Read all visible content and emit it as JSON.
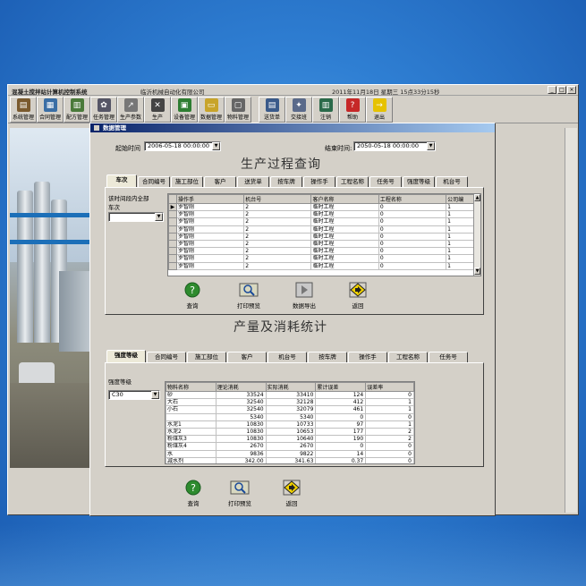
{
  "window": {
    "title": "混凝土搅拌站计算机控制系统",
    "company": "临沂机械自动化有限公司",
    "datetime": "2011年11月18日  星期三  15点33分15秒",
    "min": "_",
    "max": "□",
    "close": "×"
  },
  "toolbar": [
    {
      "label": "系统管理",
      "icon": "#7a5a2e",
      "glyph": "▤"
    },
    {
      "label": "合同管理",
      "icon": "#3a6ea5",
      "glyph": "▦"
    },
    {
      "label": "配方管理",
      "icon": "#4a7a3a",
      "glyph": "▥"
    },
    {
      "label": "任务管理",
      "icon": "#556",
      "glyph": "✿"
    },
    {
      "label": "生产参数",
      "icon": "#777",
      "glyph": "↗"
    },
    {
      "label": "生产",
      "icon": "#444",
      "glyph": "✕"
    },
    {
      "label": "设备管理",
      "icon": "#2e7d32",
      "glyph": "▣"
    },
    {
      "label": "数据管理",
      "icon": "#c8a42a",
      "glyph": "▭"
    },
    {
      "label": "物料管理",
      "icon": "#666",
      "glyph": "▢"
    },
    {
      "label": "送货单",
      "icon": "#3a5a8a",
      "glyph": "▤"
    },
    {
      "label": "交接班",
      "icon": "#5a6a8a",
      "glyph": "✦"
    },
    {
      "label": "注销",
      "icon": "#2a6a4a",
      "glyph": "▥"
    },
    {
      "label": "帮助",
      "icon": "#c62828",
      "glyph": "?"
    },
    {
      "label": "退出",
      "icon": "#e6c200",
      "glyph": "→"
    }
  ],
  "dialog": {
    "title": "数据管理",
    "start_label": "起始时间",
    "start_value": "2006-05-18 00:00:00",
    "end_label": "结束时间:",
    "end_value": "2050-05-18 00:00:00",
    "section1_title": "生产过程查询",
    "section2_title": "产量及消耗统计",
    "tabs1": [
      "车次",
      "合同编号",
      "施工部位",
      "客户",
      "送货单",
      "按车牌",
      "操作手",
      "工程名称",
      "任务号",
      "强度等级",
      "机台号"
    ],
    "panel1_hint": "该时间段内全部",
    "panel1_filter_label": "车次",
    "grid1": {
      "headers": [
        "操作手",
        "机台号",
        "客户名称",
        "工程名称",
        "公司编"
      ],
      "rows": [
        [
          "罗智刚",
          "2",
          "临时工程",
          "0",
          "1"
        ],
        [
          "罗智刚",
          "2",
          "临时工程",
          "0",
          "1"
        ],
        [
          "罗智刚",
          "2",
          "临时工程",
          "0",
          "1"
        ],
        [
          "罗智刚",
          "2",
          "临时工程",
          "0",
          "1"
        ],
        [
          "罗智刚",
          "2",
          "临时工程",
          "0",
          "1"
        ],
        [
          "罗智刚",
          "2",
          "临时工程",
          "0",
          "1"
        ],
        [
          "罗智刚",
          "2",
          "临时工程",
          "0",
          "1"
        ],
        [
          "罗智刚",
          "2",
          "临时工程",
          "0",
          "1"
        ],
        [
          "罗智刚",
          "2",
          "临时工程",
          "0",
          "1"
        ]
      ]
    },
    "actions1": [
      {
        "label": "查询",
        "kind": "query"
      },
      {
        "label": "打印预览",
        "kind": "print"
      },
      {
        "label": "数据导出",
        "kind": "export"
      },
      {
        "label": "返回",
        "kind": "back"
      }
    ],
    "tabs2": [
      "强度等级",
      "合同编号",
      "施工部位",
      "客户",
      "机台号",
      "按车牌",
      "操作手",
      "工程名称",
      "任务号"
    ],
    "panel2_filter_label": "强度等级",
    "panel2_filter_value": "C30",
    "grid2": {
      "headers": [
        "物料名称",
        "理论消耗",
        "实际消耗",
        "累计误差",
        "误差率"
      ],
      "rows": [
        [
          "砂",
          "33524",
          "33410",
          "124",
          "0"
        ],
        [
          "大石",
          "32540",
          "32128",
          "412",
          "1"
        ],
        [
          "小石",
          "32540",
          "32079",
          "461",
          "1"
        ],
        [
          "",
          "5340",
          "5340",
          "0",
          "0"
        ],
        [
          "水泥1",
          "10830",
          "10733",
          "97",
          "1"
        ],
        [
          "水泥2",
          "10830",
          "10653",
          "177",
          "2"
        ],
        [
          "粉煤灰3",
          "10830",
          "10640",
          "190",
          "2"
        ],
        [
          "粉煤灰4",
          "2670",
          "2670",
          "0",
          "0"
        ],
        [
          "水",
          "9836",
          "9822",
          "14",
          "0"
        ],
        [
          "减水剂",
          "342.00",
          "341.63",
          "0.37",
          "0"
        ]
      ]
    },
    "actions2": [
      {
        "label": "查询",
        "kind": "query"
      },
      {
        "label": "打印预览",
        "kind": "print"
      },
      {
        "label": "返回",
        "kind": "back"
      }
    ]
  },
  "colors": {
    "desktop": "#2f7fd3",
    "title_gradient_start": "#0a246a",
    "query_icon": "#2e8b2e",
    "back_icon": "#f2d200"
  }
}
